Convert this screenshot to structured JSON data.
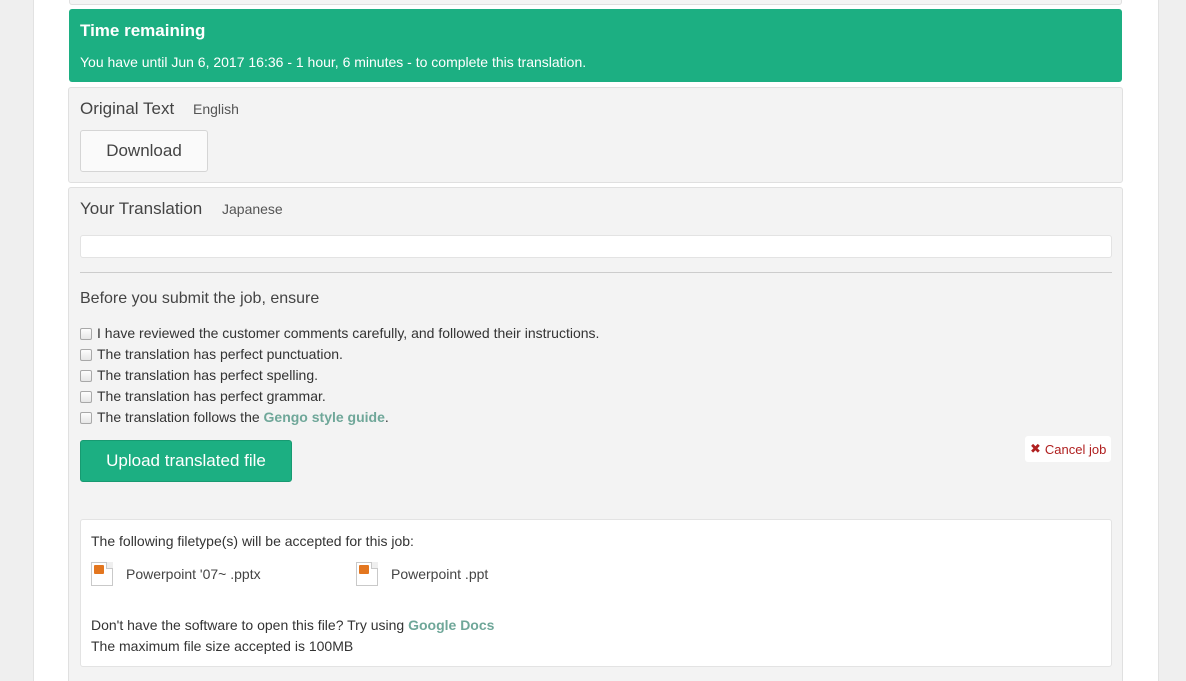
{
  "time_banner": {
    "title": "Time remaining",
    "message": "You have until Jun 6, 2017 16:36 - 1 hour, 6 minutes - to complete this translation."
  },
  "original": {
    "heading": "Original Text",
    "language": "English",
    "download_label": "Download"
  },
  "translation": {
    "heading": "Your Translation",
    "language": "Japanese",
    "field_value": ""
  },
  "checklist": {
    "title": "Before you submit the job, ensure",
    "items": [
      "I have reviewed the customer comments carefully, and followed their instructions.",
      "The translation has perfect punctuation.",
      "The translation has perfect spelling.",
      "The translation has perfect grammar."
    ],
    "style_item": {
      "prefix": "The translation follows the ",
      "link": "Gengo style guide",
      "suffix": "."
    }
  },
  "actions": {
    "upload_label": "Upload translated file",
    "cancel_label": "Cancel job"
  },
  "filetypes": {
    "title": "The following filetype(s) will be accepted for this job:",
    "types": [
      {
        "label": "Powerpoint '07~ .pptx",
        "icon": "pptx-file-icon"
      },
      {
        "label": "Powerpoint .ppt",
        "icon": "ppt-file-icon"
      }
    ],
    "software_note": "Don't have the software to open this file? Try using ",
    "software_link": "Google Docs",
    "max_size": "The maximum file size accepted is 100MB"
  },
  "colors": {
    "accent_green": "#1caf82",
    "link_green": "#6fa799",
    "cancel_red": "#b02020"
  }
}
